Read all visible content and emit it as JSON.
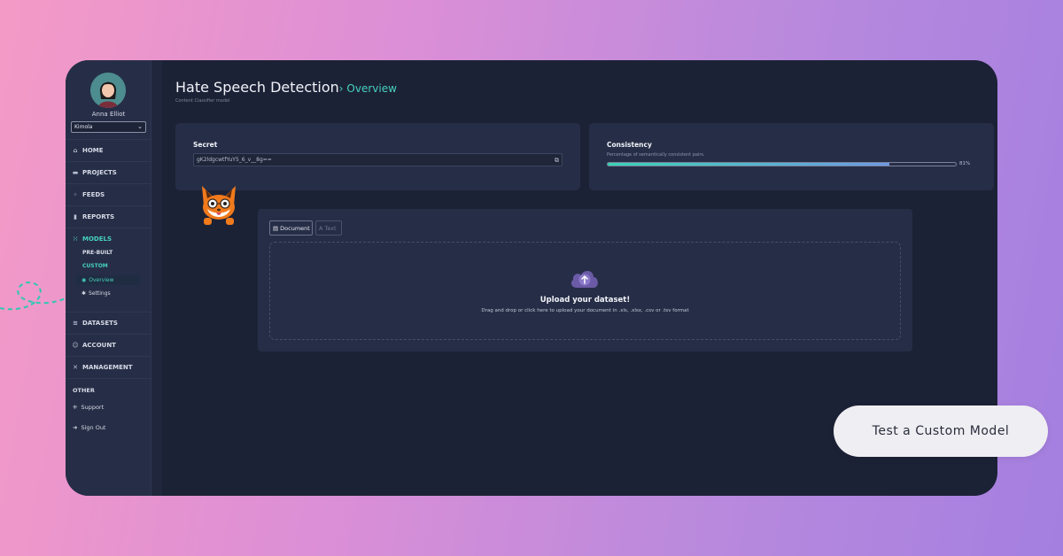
{
  "user": {
    "name": "Anna Elliot",
    "organization": "Kimola"
  },
  "sidebar": {
    "items": [
      {
        "label": "HOME",
        "icon": "home-icon"
      },
      {
        "label": "PROJECTS",
        "icon": "folder-icon"
      },
      {
        "label": "FEEDS",
        "icon": "feed-icon"
      },
      {
        "label": "REPORTS",
        "icon": "chart-icon"
      },
      {
        "label": "MODELS",
        "icon": "models-icon"
      },
      {
        "label": "DATASETS",
        "icon": "database-icon"
      },
      {
        "label": "ACCOUNT",
        "icon": "account-icon"
      },
      {
        "label": "MANAGEMENT",
        "icon": "tools-icon"
      }
    ],
    "models_sub": {
      "prebuilt": "PRE-BUILT",
      "custom": "CUSTOM",
      "overview": "Overview",
      "settings": "Settings"
    },
    "other_label": "OTHER",
    "support": "Support",
    "sign_out": "Sign Out"
  },
  "page": {
    "title": "Hate Speech Detection",
    "breadcrumb": "Overview",
    "subtitle": "Content Classifier model"
  },
  "secret": {
    "label": "Secret",
    "value": "gK2ldgcwtfYuY5_6_v__8g=="
  },
  "consistency": {
    "label": "Consistency",
    "description": "Percentage of semantically consistent pairs.",
    "value": 0.81,
    "value_label": "81%"
  },
  "upload": {
    "tabs": [
      "Document",
      "Text"
    ],
    "active_tab": "Document",
    "title": "Upload your dataset!",
    "hint": "Drag and drop or click here to upload your document in .xls, .xlsx, .csv or .tsv format"
  },
  "cta": {
    "label": "Test a Custom Model"
  },
  "colors": {
    "accent": "#46d1bf",
    "background": "#1c2236",
    "panel": "#262e47",
    "upload_icon": "#6b5aa6"
  }
}
